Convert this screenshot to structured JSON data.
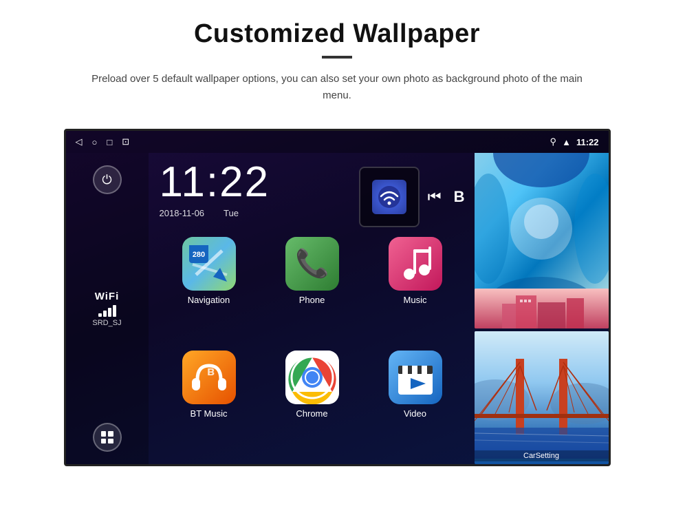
{
  "header": {
    "title": "Customized Wallpaper",
    "subtitle": "Preload over 5 default wallpaper options, you can also set your own photo as background photo of the main menu."
  },
  "phone": {
    "status_bar": {
      "back_icon": "◁",
      "home_icon": "○",
      "recent_icon": "□",
      "screenshot_icon": "⊡",
      "location_icon": "⚲",
      "signal_icon": "▲",
      "time": "11:22"
    },
    "clock": {
      "time": "11:22",
      "date": "2018-11-06",
      "day": "Tue"
    },
    "wifi": {
      "label": "WiFi",
      "ssid": "SRD_SJ"
    },
    "apps": [
      {
        "id": "navigation",
        "label": "Navigation",
        "type": "nav"
      },
      {
        "id": "phone",
        "label": "Phone",
        "type": "phone"
      },
      {
        "id": "music",
        "label": "Music",
        "type": "music"
      },
      {
        "id": "bt_music",
        "label": "BT Music",
        "type": "bt"
      },
      {
        "id": "chrome",
        "label": "Chrome",
        "type": "chrome"
      },
      {
        "id": "video",
        "label": "Video",
        "type": "video"
      }
    ],
    "wallpapers": [
      {
        "id": "ice",
        "label": "Ice"
      },
      {
        "id": "building",
        "label": "Building"
      },
      {
        "id": "bridge",
        "label": "CarSetting"
      }
    ]
  }
}
